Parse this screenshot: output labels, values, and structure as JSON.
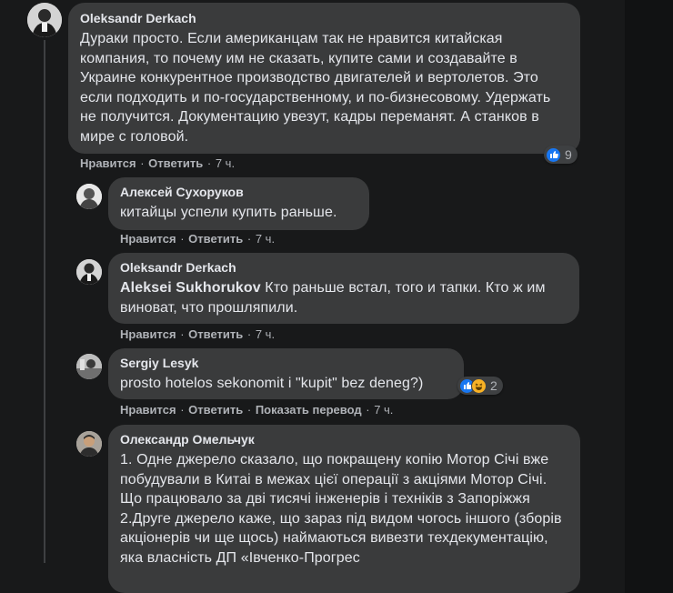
{
  "comments": [
    {
      "author": "Oleksandr Derkach",
      "text": "Дураки просто. Если американцам так не нравится китайская компания, то почему им не сказать, купите сами и создавайте в Украине конкурентное производство двигателей и вертолетов. Это если подходить и по-государственному, и по-бизнесовому. Удержать не получится. Документацию увезут, кадры переманят. А станков в мире с головой.",
      "like": "Нравится",
      "reply": "Ответить",
      "time": "7 ч.",
      "reaction_count": "9"
    },
    {
      "author": "Алексей Сухоруков",
      "text": "китайцы успели купить раньше.",
      "like": "Нравится",
      "reply": "Ответить",
      "time": "7 ч."
    },
    {
      "author": "Oleksandr Derkach",
      "mention": "Aleksei Sukhorukov",
      "text": " Кто раньше встал, того и тапки. Кто ж им виноват, что прошляпили.",
      "like": "Нравится",
      "reply": "Ответить",
      "time": "7 ч."
    },
    {
      "author": "Sergiy Lesyk",
      "text": "prosto hotelos sekonomit i \"kupit\" bez deneg?)",
      "like": "Нравится",
      "reply": "Ответить",
      "translate": "Показать перевод",
      "time": "7 ч.",
      "reaction_count": "2"
    },
    {
      "author": "Олександр Омельчук",
      "text": "1. Одне джерело сказало, що покращену копію Мотор Січі вже побудували в Китаі в межах цієї операції з акціями Мотор Січі. Що працювало за дві тисячі інженерів і техніків з Запоріжжя 2.Друге джерело каже, що зараз під видом чогось іншого (зборів акціонерів чи ще щось) наймаються вивезти техдекументацію, яка власність ДП «Івченко-Прогрес"
    }
  ],
  "colors": {
    "background": "#18191a",
    "bubble": "#3a3b3c",
    "text": "#e4e6eb",
    "secondary": "#b0b3b8",
    "like_blue": "#1877f2",
    "haha_yellow": "#f7b125"
  },
  "icons": [
    "like-icon",
    "haha-icon"
  ]
}
